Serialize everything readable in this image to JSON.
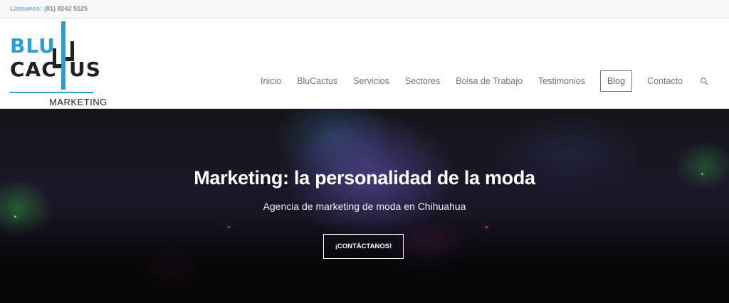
{
  "topbar": {
    "call_label": "Llámanos:",
    "phone": "(81) 8242 5125"
  },
  "logo": {
    "line1": "BLU",
    "line2a": "CAC",
    "line2b": "US",
    "tagline": "MARKETING"
  },
  "nav": {
    "items": [
      "Inicio",
      "BluCactus",
      "Servicios",
      "Sectores",
      "Bolsa de Trabajo",
      "Testimonios",
      "Blog",
      "Contacto"
    ],
    "active": "Blog",
    "search_icon": "search-icon"
  },
  "hero": {
    "title": "Marketing: la personalidad de la moda",
    "subtitle": "Agencia de marketing de moda en Chihuahua",
    "cta_label": "¡CONTÁCTANOS!"
  },
  "colors": {
    "brand_blue": "#2a9fd6",
    "nav_text": "#777777"
  }
}
